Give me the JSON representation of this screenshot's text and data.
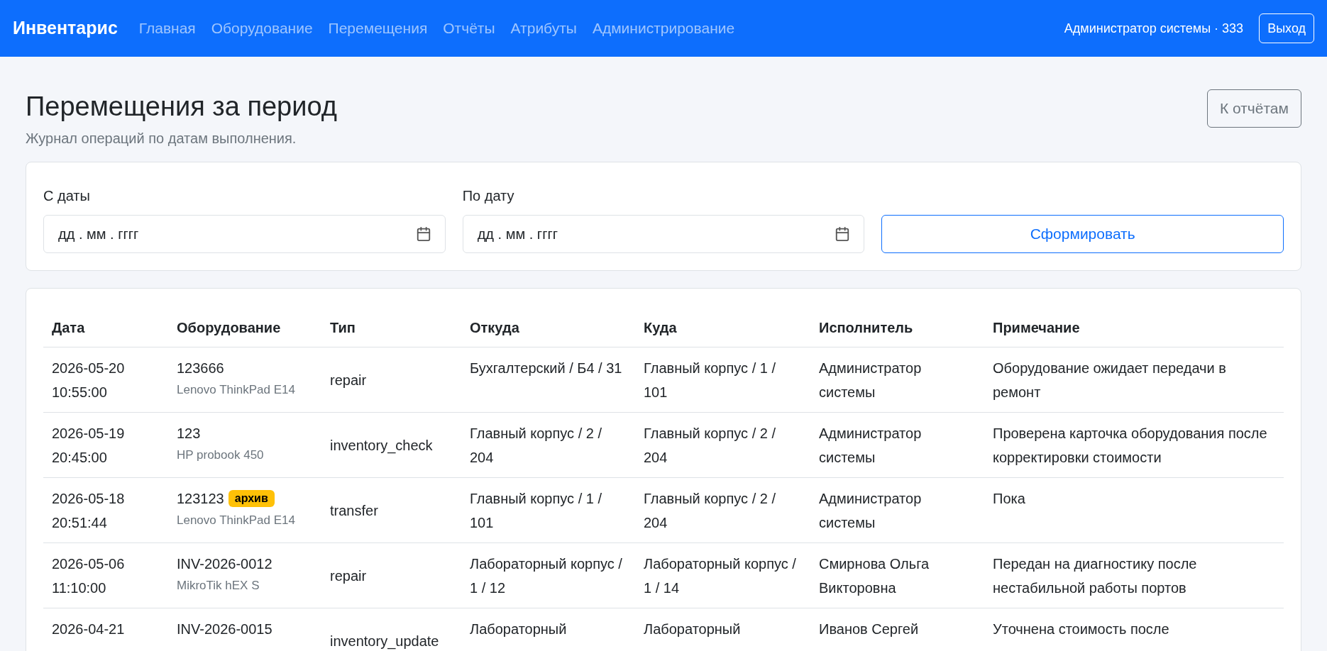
{
  "navbar": {
    "brand": "Инвентарис",
    "links": [
      "Главная",
      "Оборудование",
      "Перемещения",
      "Отчёты",
      "Атрибуты",
      "Администрирование"
    ],
    "user": "Администратор системы · 333",
    "logout": "Выход"
  },
  "header": {
    "title": "Перемещения за период",
    "subtitle": "Журнал операций по датам выполнения.",
    "back_button": "К отчётам"
  },
  "filter": {
    "fields": [
      {
        "label": "С даты",
        "placeholder": "дд . мм . гггг"
      },
      {
        "label": "По дату",
        "placeholder": "дд . мм . гггг"
      }
    ],
    "submit": "Сформировать"
  },
  "table": {
    "columns": [
      "Дата",
      "Оборудование",
      "Тип",
      "Откуда",
      "Куда",
      "Исполнитель",
      "Примечание"
    ],
    "rows": [
      {
        "date": "2026-05-20",
        "time": "10:55:00",
        "code": "123666",
        "model": "Lenovo ThinkPad E14",
        "badge": "",
        "type": "repair",
        "from": "Бухгалтерский / Б4 / 31",
        "to": "Главный корпус / 1 / 101",
        "performer": "Администратор системы",
        "note": "Оборудование ожидает передачи в ремонт"
      },
      {
        "date": "2026-05-19",
        "time": "20:45:00",
        "code": "123",
        "model": "HP probook 450",
        "badge": "",
        "type": "inventory_check",
        "from": "Главный корпус / 2 / 204",
        "to": "Главный корпус / 2 / 204",
        "performer": "Администратор системы",
        "note": "Проверена карточка оборудования после корректировки стоимости"
      },
      {
        "date": "2026-05-18",
        "time": "20:51:44",
        "code": "123123",
        "model": "Lenovo ThinkPad E14",
        "badge": "архив",
        "type": "transfer",
        "from": "Главный корпус / 1 / 101",
        "to": "Главный корпус / 2 / 204",
        "performer": "Администратор системы",
        "note": "Пока"
      },
      {
        "date": "2026-05-06",
        "time": "11:10:00",
        "code": "INV-2026-0012",
        "model": "MikroTik hEX S",
        "badge": "",
        "type": "repair",
        "from": "Лабораторный корпус / 1 / 12",
        "to": "Лабораторный корпус / 1 / 14",
        "performer": "Смирнова Ольга Викторовна",
        "note": "Передан на диагностику после нестабильной работы портов"
      },
      {
        "date": "2026-04-21",
        "time": "",
        "code": "INV-2026-0015",
        "model": "",
        "badge": "",
        "type": "inventory_update",
        "from": "Лабораторный",
        "to": "Лабораторный",
        "performer": "Иванов Сергей",
        "note": "Уточнена стоимость после"
      }
    ]
  }
}
